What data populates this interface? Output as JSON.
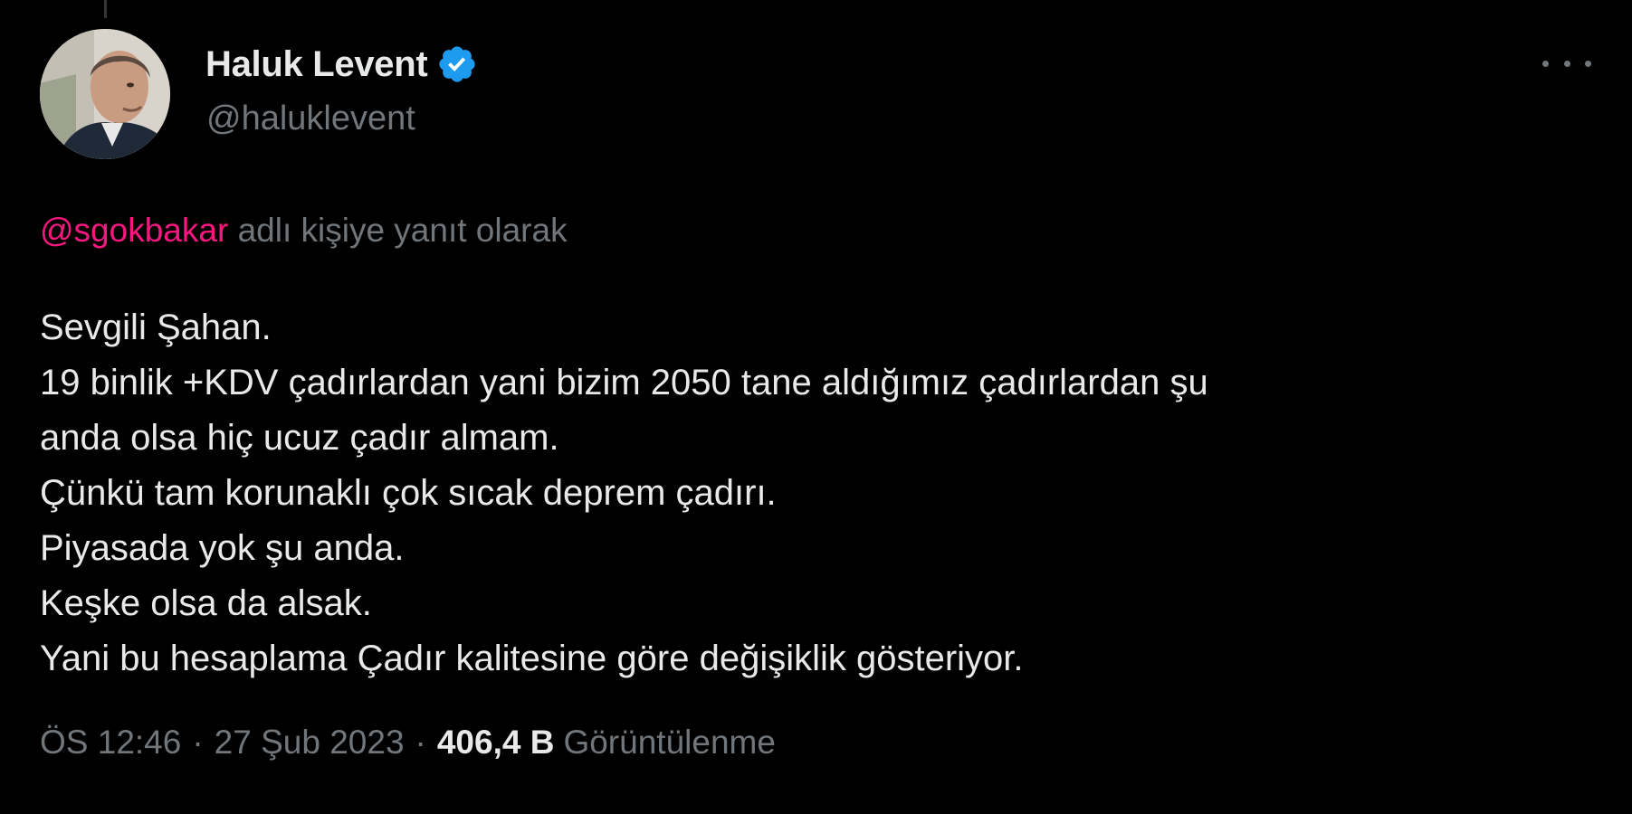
{
  "tweet": {
    "author": {
      "display_name": "Haluk Levent",
      "handle": "@haluklevent",
      "verified": true,
      "verified_color": "#1d9bf0"
    },
    "reply_context": {
      "mention": "@sgokbakar",
      "suffix": "adlı kişiye yanıt olarak",
      "mention_color": "#f91880"
    },
    "body_lines": [
      "Sevgili Şahan.",
      "19 binlik +KDV çadırlardan yani bizim 2050 tane aldığımız çadırlardan şu",
      "anda olsa hiç ucuz çadır almam.",
      "Çünkü tam korunaklı çok sıcak deprem çadırı.",
      "Piyasada yok şu anda.",
      "Keşke olsa da alsak.",
      "Yani bu hesaplama Çadır kalitesine göre değişiklik gösteriyor."
    ],
    "meta": {
      "time": "ÖS 12:46",
      "separator": "·",
      "date": "27 Şub 2023",
      "views_count": "406,4 B",
      "views_label": "Görüntülenme"
    }
  },
  "icons": {
    "verified": "verified-badge-icon",
    "more": "more-options-icon"
  },
  "colors": {
    "background": "#000000",
    "primary_text": "#e7e9ea",
    "secondary_text": "#71767b"
  }
}
